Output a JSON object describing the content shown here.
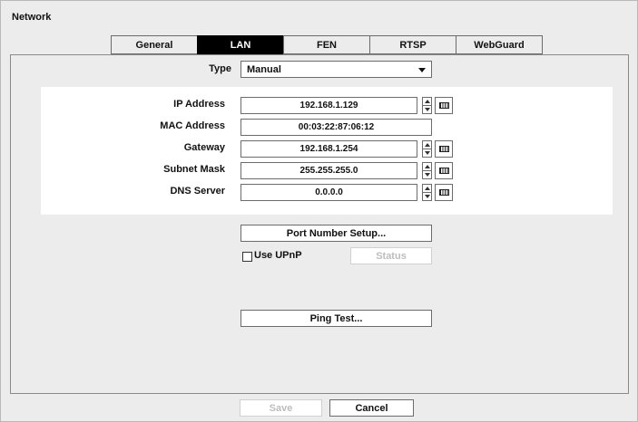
{
  "window": {
    "title": "Network"
  },
  "tabs": [
    {
      "label": "General",
      "active": false
    },
    {
      "label": "LAN",
      "active": true
    },
    {
      "label": "FEN",
      "active": false
    },
    {
      "label": "RTSP",
      "active": false
    },
    {
      "label": "WebGuard",
      "active": false
    }
  ],
  "type": {
    "label": "Type",
    "value": "Manual"
  },
  "ip_fields": {
    "ip_address": {
      "label": "IP Address",
      "value": "192.168.1.129"
    },
    "mac_address": {
      "label": "MAC Address",
      "value": "00:03:22:87:06:12"
    },
    "gateway": {
      "label": "Gateway",
      "value": "192.168.1.254"
    },
    "subnet_mask": {
      "label": "Subnet Mask",
      "value": "255.255.255.0"
    },
    "dns_server": {
      "label": "DNS Server",
      "value": "0.0.0.0"
    }
  },
  "port_button": {
    "label": "Port Number Setup..."
  },
  "upnp": {
    "label": "Use UPnP",
    "checked": false,
    "status_label": "Status"
  },
  "ping_button": {
    "label": "Ping Test..."
  },
  "footer": {
    "save_label": "Save",
    "cancel_label": "Cancel"
  },
  "icons": {
    "spinner": "up-down-arrows-icon",
    "keyboard": "keyboard-icon",
    "dropdown": "chevron-down-icon"
  },
  "colors": {
    "active_tab_bg": "#000000",
    "active_tab_fg": "#ffffff",
    "panel_bg": "#ececec"
  }
}
